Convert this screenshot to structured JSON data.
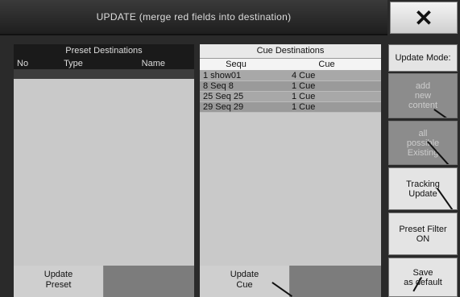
{
  "dialog": {
    "title": "UPDATE (merge red fields into destination)"
  },
  "close_button": {
    "glyph": "✕"
  },
  "preset_panel": {
    "title": "Preset Destinations",
    "columns": {
      "no": "No",
      "type": "Type",
      "name": "Name"
    },
    "rows": [
      {
        "no": "",
        "type": "",
        "name": ""
      }
    ]
  },
  "cue_panel": {
    "title": "Cue Destinations",
    "columns": {
      "sequ": "Sequ",
      "cue": "Cue"
    },
    "rows": [
      {
        "sequ": "1 show01",
        "cue": "4 Cue"
      },
      {
        "sequ": "8 Seq 8",
        "cue": "1 Cue"
      },
      {
        "sequ": "25 Seq 25",
        "cue": "1 Cue"
      },
      {
        "sequ": "29 Seq 29",
        "cue": "1 Cue"
      }
    ]
  },
  "buttons": {
    "update_preset": [
      "Update",
      "Preset"
    ],
    "update_cue": [
      "Update",
      "Cue"
    ],
    "update_mode": "Update Mode:",
    "add_new_content": [
      "add",
      "new",
      "content"
    ],
    "all_possible_existing": [
      "all",
      "possible",
      "Existing"
    ],
    "tracking_update": [
      "Tracking",
      "Update"
    ],
    "preset_filter_on": [
      "Preset Filter",
      "ON"
    ],
    "save_as_default": [
      "Save",
      "as default"
    ]
  }
}
